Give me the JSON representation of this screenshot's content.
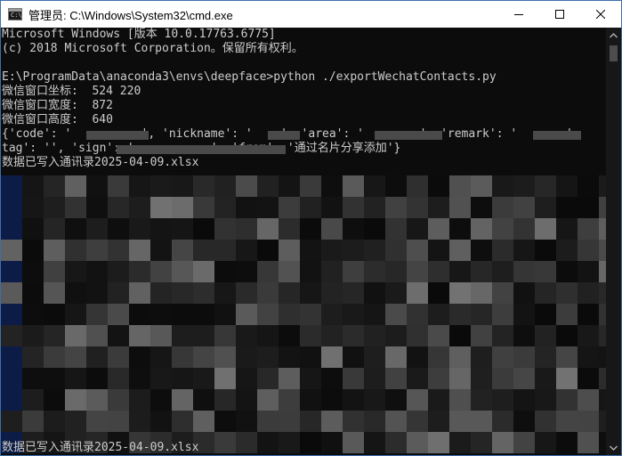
{
  "window": {
    "title": "管理员: C:\\Windows\\System32\\cmd.exe",
    "icon": "cmd-icon"
  },
  "console": {
    "lines": [
      "Microsoft Windows [版本 10.0.17763.6775]",
      "(c) 2018 Microsoft Corporation。保留所有权利。",
      "",
      "E:\\ProgramData\\anaconda3\\envs\\deepface>python ./exportWechatContacts.py",
      "微信窗口坐标:  524 220",
      "微信窗口宽度:  872",
      "微信窗口高度:  640",
      "{'code': '          ', 'nickname': '    ', 'area': '        ', 'remark': '       ',",
      "tag': '', 'sign': '           ', 'from': '通过名片分享添加'}",
      "数据已写入通讯录2025-04-09.xlsx"
    ],
    "last_line": "数据已写入通讯录2025-04-09.xlsx"
  },
  "colors": {
    "console_bg": "#0c0c0c",
    "console_fg": "#cccccc",
    "titlebar_bg": "#ffffff",
    "border": "#3c6fa8"
  }
}
